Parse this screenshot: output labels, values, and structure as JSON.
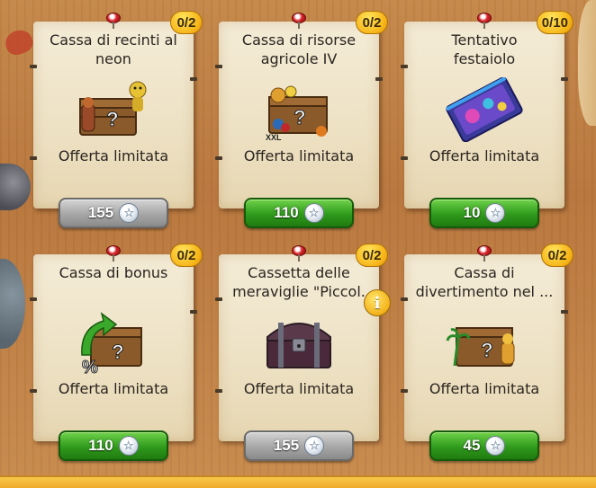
{
  "offers": [
    {
      "title": "Cassa di recinti al\nneon",
      "counter": "0/2",
      "subtitle": "Offerta limitata",
      "price": "155",
      "button_style": "gray",
      "art_icon": "chest-with-monkey-icon"
    },
    {
      "title": "Cassa di risorse\nagricole IV",
      "counter": "0/2",
      "subtitle": "Offerta limitata",
      "price": "110",
      "button_style": "green",
      "art_icon": "resource-chest-icon"
    },
    {
      "title": "Tentativo\nfestaiolo",
      "counter": "0/10",
      "subtitle": "Offerta limitata",
      "price": "10",
      "button_style": "green",
      "art_icon": "party-ticket-icon"
    },
    {
      "title": "Cassa di bonus",
      "counter": "0/2",
      "subtitle": "Offerta limitata",
      "price": "110",
      "button_style": "green",
      "art_icon": "bonus-chest-icon"
    },
    {
      "title": "Cassetta delle\nmeraviglie \"Piccol.",
      "counter": "0/2",
      "subtitle": "Offerta limitata",
      "price": "155",
      "button_style": "gray",
      "art_icon": "treasure-chest-icon"
    },
    {
      "title": "Cassa di\ndivertimento nel ...",
      "counter": "0/2",
      "subtitle": "Offerta limitata",
      "price": "45",
      "button_style": "green",
      "art_icon": "fun-chest-icon"
    }
  ],
  "info_icon_glyph": "i",
  "gem_glyph": "☆",
  "colors": {
    "green_button": "#2f9a1c",
    "gray_button": "#a6a6a6",
    "counter_badge": "#f6b316",
    "paper": "#f4ecd7"
  }
}
